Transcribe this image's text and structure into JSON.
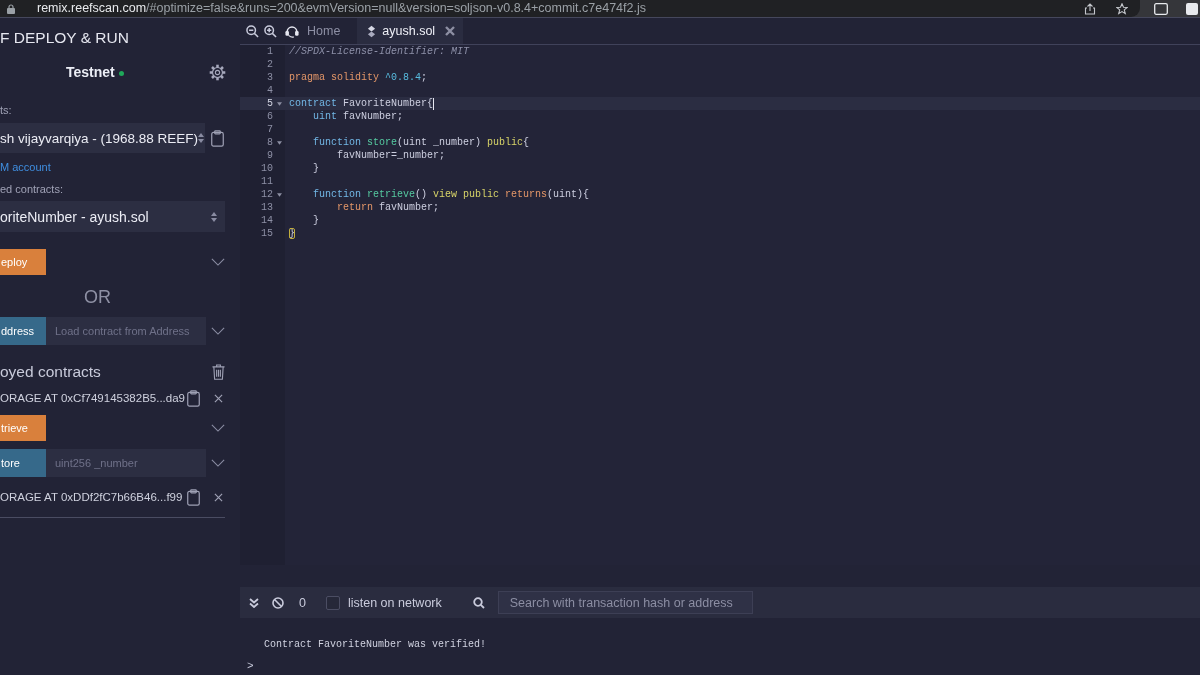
{
  "browser": {
    "url_host": "remix.reefscan.com",
    "url_path": "/#optimize=false&runs=200&evmVersion=null&version=soljson-v0.8.4+commit.c7e474f2.js"
  },
  "panel": {
    "title": "F DEPLOY & RUN",
    "network": "Testnet",
    "network_connected": true,
    "account_label": "ts:",
    "account": "sh vijayvarqiya - (1968.88 REEF)",
    "account_link": "M account",
    "contracts_label": "ed contracts:",
    "contract": "oriteNumber - ayush.sol",
    "deploy_button": "eploy",
    "or_text": "OR",
    "at_address_button": "ddress",
    "at_address_placeholder": "Load contract from Address",
    "deployed_title": "oyed contracts",
    "instances": [
      {
        "title": "ORAGE AT 0xCf749145382B5...da9",
        "functions": [
          {
            "name": "trieve",
            "kind": "call"
          },
          {
            "name": "tore",
            "kind": "transact",
            "placeholder": "uint256 _number"
          }
        ]
      },
      {
        "title": "ORAGE AT 0xDDf2fC7b66B46...f99"
      }
    ]
  },
  "tabs": [
    {
      "label": "Home",
      "kind": "home",
      "selected": false,
      "closable": false
    },
    {
      "label": "ayush.sol",
      "kind": "file",
      "selected": true,
      "closable": true
    }
  ],
  "editor": {
    "lines": [
      {
        "number": "1",
        "foldable": false,
        "active": false,
        "tokens": [
          {
            "text": "//SPDX-License-Identifier: MIT",
            "kind": "comment"
          }
        ]
      },
      {
        "number": "2",
        "foldable": false,
        "active": false
      },
      {
        "number": "3",
        "foldable": false,
        "active": false,
        "tokens": [
          {
            "text": "pragma solidity ",
            "kind": "directive"
          },
          {
            "text": "^0.8.4",
            "kind": "number"
          },
          {
            "text": ";",
            "kind": "plain"
          }
        ]
      },
      {
        "number": "4",
        "foldable": false,
        "active": false
      },
      {
        "number": "5",
        "foldable": true,
        "active": true,
        "tokens": [
          {
            "text": "contract ",
            "kind": "keyword"
          },
          {
            "text": "FavoriteNumber{",
            "kind": "plain"
          }
        ]
      },
      {
        "number": "6",
        "foldable": false,
        "active": false,
        "tokens": [
          {
            "text": "    uint",
            "kind": "keyword"
          },
          {
            "text": " favNumber;",
            "kind": "plain"
          }
        ]
      },
      {
        "number": "7",
        "foldable": false,
        "active": false
      },
      {
        "number": "8",
        "foldable": true,
        "active": false,
        "tokens": [
          {
            "text": "    function ",
            "kind": "keyword"
          },
          {
            "text": "store",
            "kind": "function"
          },
          {
            "text": "(uint _number) ",
            "kind": "plain"
          },
          {
            "text": "public",
            "kind": "modifier"
          },
          {
            "text": "{",
            "kind": "plain"
          }
        ]
      },
      {
        "number": "9",
        "foldable": false,
        "active": false,
        "tokens": [
          {
            "text": "        favNumber=_number;",
            "kind": "plain"
          }
        ]
      },
      {
        "number": "10",
        "foldable": false,
        "active": false,
        "tokens": [
          {
            "text": "    }",
            "kind": "plain"
          }
        ]
      },
      {
        "number": "11",
        "foldable": false,
        "active": false
      },
      {
        "number": "12",
        "foldable": true,
        "active": false,
        "tokens": [
          {
            "text": "    function ",
            "kind": "keyword"
          },
          {
            "text": "retrieve",
            "kind": "function"
          },
          {
            "text": "() ",
            "kind": "plain"
          },
          {
            "text": "view public ",
            "kind": "modifier"
          },
          {
            "text": "returns",
            "kind": "directive"
          },
          {
            "text": "(uint){",
            "kind": "plain"
          }
        ]
      },
      {
        "number": "13",
        "foldable": false,
        "active": false,
        "tokens": [
          {
            "text": "        return",
            "kind": "directive"
          },
          {
            "text": " favNumber;",
            "kind": "plain"
          }
        ]
      },
      {
        "number": "14",
        "foldable": false,
        "active": false,
        "tokens": [
          {
            "text": "    }",
            "kind": "plain"
          }
        ]
      },
      {
        "number": "15",
        "foldable": false,
        "active": false,
        "tokens": [
          {
            "text": "}",
            "kind": "bracket"
          }
        ]
      }
    ]
  },
  "terminal": {
    "message_count": "0",
    "listen_label": "listen on network",
    "listen_checked": false,
    "search_placeholder": "Search with transaction hash or address",
    "logs": [
      "Contract FavoriteNumber was verified!"
    ],
    "prompt": ">"
  }
}
